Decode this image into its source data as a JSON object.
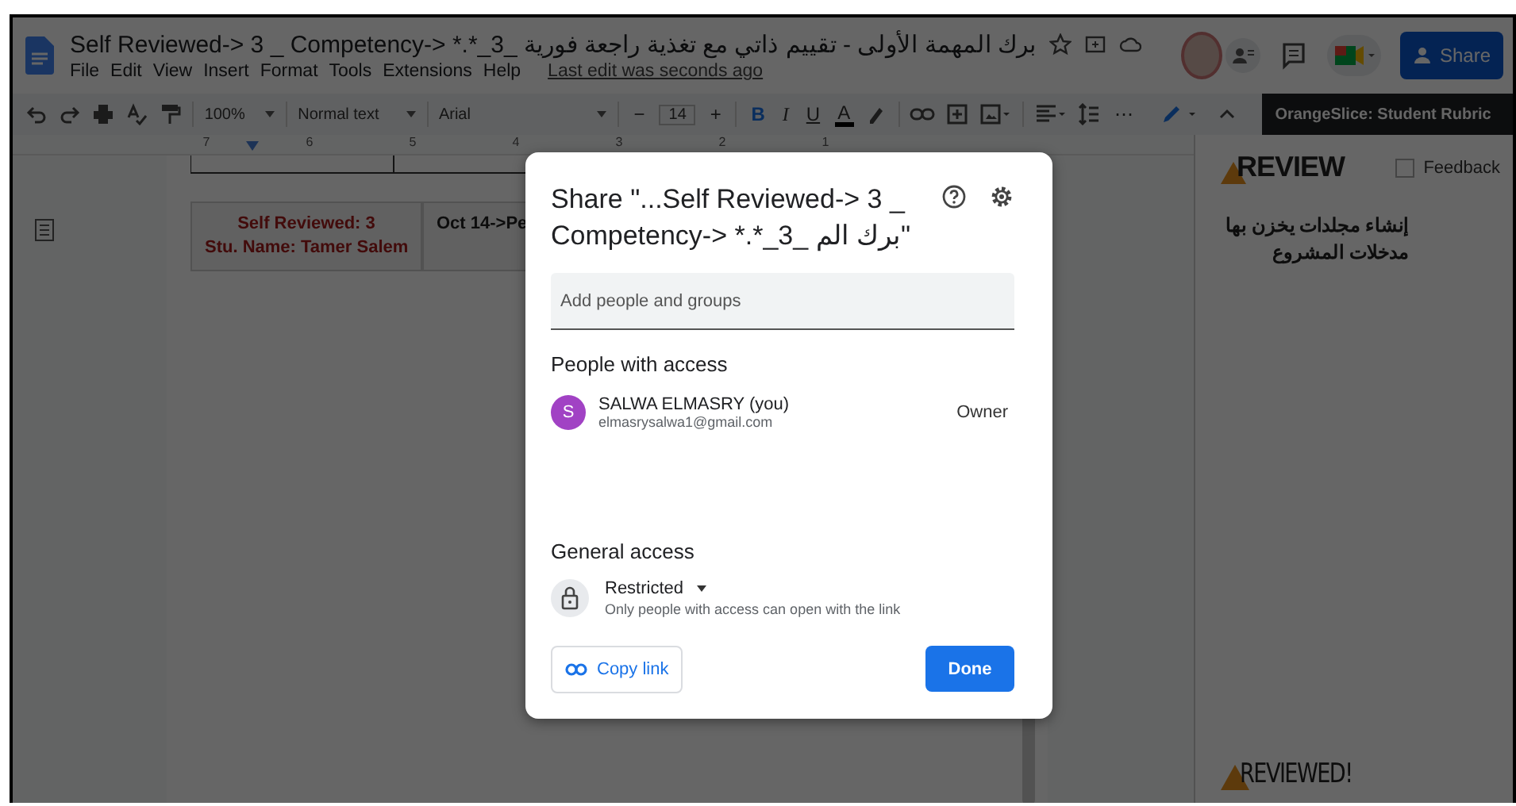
{
  "window": {
    "title": "Self Reviewed-> 3 _ Competency-> *.*_3_ برك المهمة الأولى - تقييم ذاتي مع تغذية راجعة فورية"
  },
  "menu": [
    "File",
    "Edit",
    "View",
    "Insert",
    "Format",
    "Tools",
    "Extensions",
    "Help"
  ],
  "last_edit": "Last edit was seconds ago",
  "share_button": "Share",
  "toolbar": {
    "zoom": "100%",
    "style": "Normal text",
    "font": "Arial",
    "decrease": "−",
    "font_size": "14",
    "increase": "+",
    "format_buttons": [
      {
        "kind": "bold",
        "label": "B"
      },
      {
        "kind": "italic",
        "label": "I"
      },
      {
        "kind": "underline",
        "label": "U"
      },
      {
        "kind": "color",
        "label": "A"
      }
    ],
    "more": "⋯"
  },
  "ruler": [
    "7",
    "6",
    "5",
    "4",
    "3",
    "2",
    "1"
  ],
  "document": {
    "table_cells": [
      {
        "lines": [
          "Self Reviewed: 3",
          "Stu. Name: Tamer Salem"
        ]
      },
      {
        "lines": [
          "Oct 14->Pe"
        ]
      }
    ]
  },
  "sidebar": {
    "title": "OrangeSlice: Student Rubric",
    "logo": "REVIEW",
    "feedback": {
      "label": "Feedback",
      "checked": false
    },
    "text": "إنشاء مجلدات يخزن بها مدخلات المشروع",
    "footer_logo": "REVIEWED!"
  },
  "dialog": {
    "title": "Share \"...Self Reviewed-> 3 _ Competency-> *.*_3_ برك الم\"",
    "add_field": {
      "placeholder": "Add people and groups"
    },
    "people_heading": "People with access",
    "people": [
      {
        "initial": "S",
        "name": "SALWA ELMASRY (you)",
        "email": "elmasrysalwa1@gmail.com",
        "role": "Owner"
      }
    ],
    "general_heading": "General access",
    "access": {
      "value": "Restricted",
      "description": "Only people with access can open with the link"
    },
    "copy_link": "Copy link",
    "done": "Done"
  }
}
